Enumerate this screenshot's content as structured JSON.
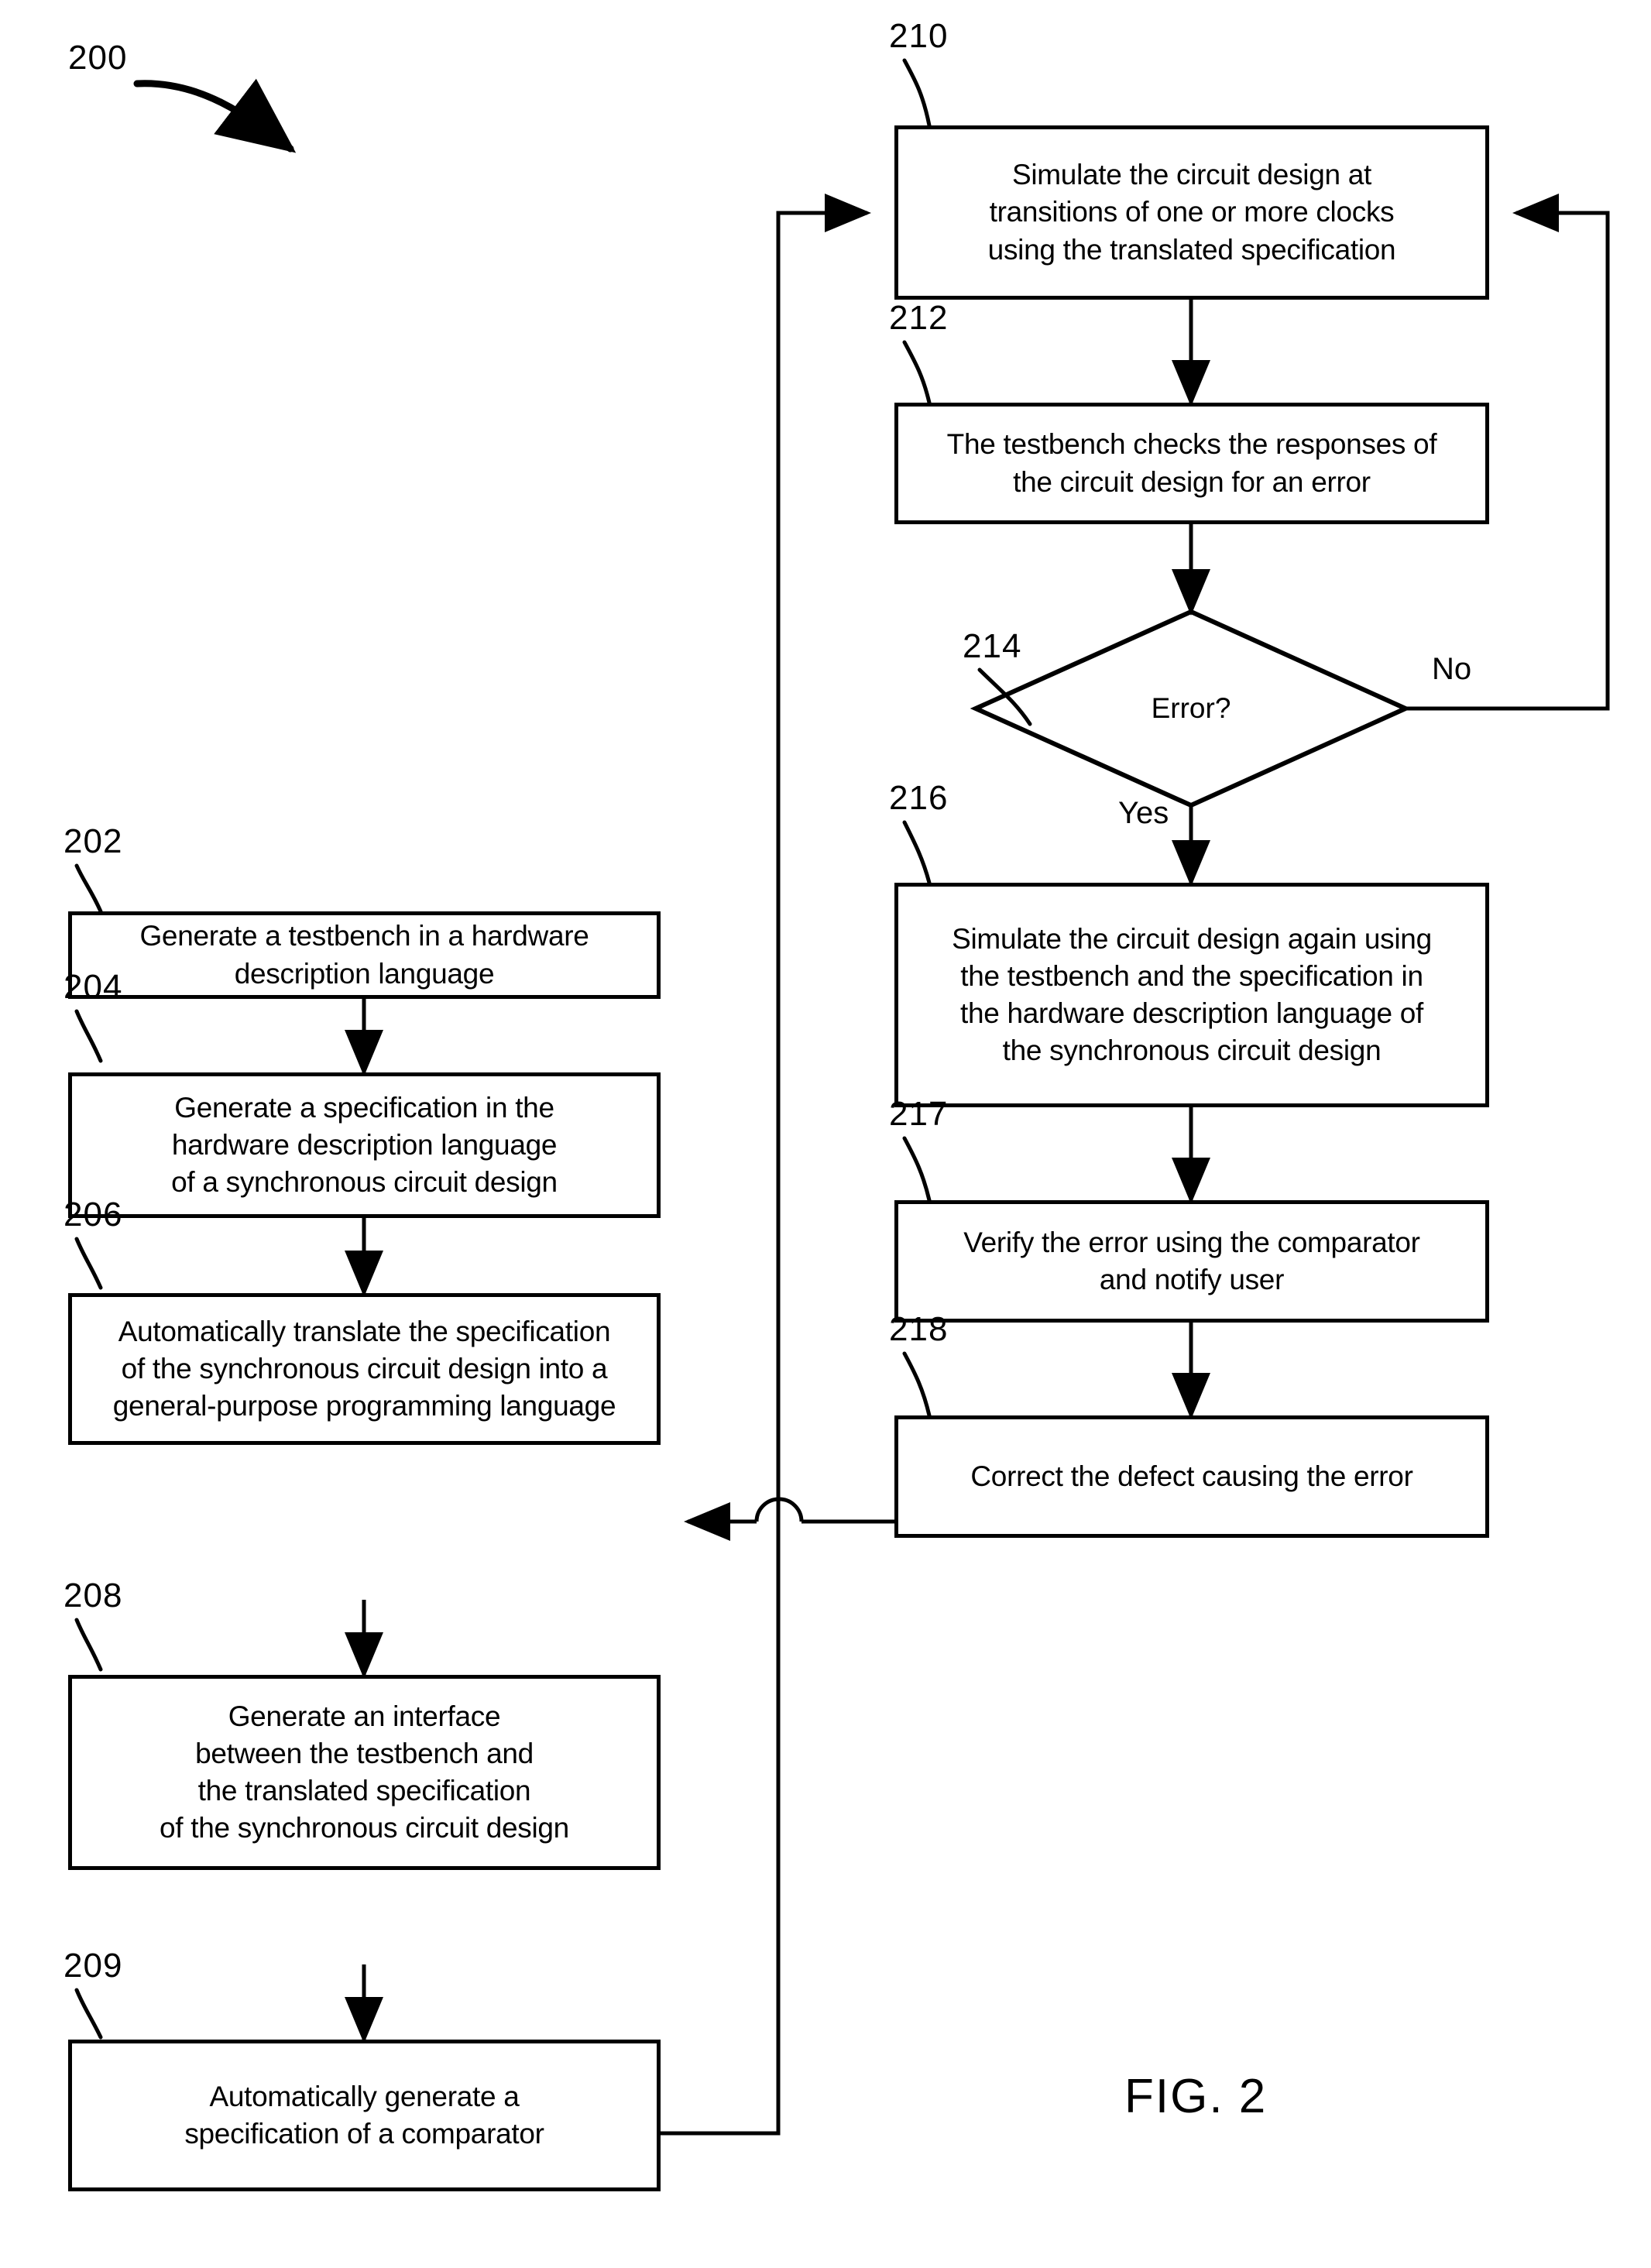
{
  "figure": {
    "caption": "FIG. 2",
    "diagram_ref": "200"
  },
  "nodes": [
    {
      "ref": "202",
      "shape": "process",
      "lines": [
        "Generate a testbench in a hardware",
        "description language"
      ],
      "text": "Generate a testbench in a hardware description language"
    },
    {
      "ref": "204",
      "shape": "process",
      "lines": [
        "Generate a specification in the",
        "hardware description language",
        "of a synchronous circuit design"
      ],
      "text": "Generate a specification in the hardware description language of a synchronous circuit design"
    },
    {
      "ref": "206",
      "shape": "process",
      "lines": [
        "Automatically translate the specification",
        "of the synchronous circuit design into a",
        "general-purpose programming language"
      ],
      "text": "Automatically translate the specification of the synchronous circuit design into a general-purpose programming language"
    },
    {
      "ref": "208",
      "shape": "process",
      "lines": [
        "Generate an interface",
        "between the testbench and",
        "the translated specification",
        "of the synchronous circuit design"
      ],
      "text": "Generate an interface between the testbench and the translated specification of the synchronous circuit design"
    },
    {
      "ref": "209",
      "shape": "process",
      "lines": [
        "Automatically generate a",
        "specification of a comparator"
      ],
      "text": "Automatically generate a specification of a comparator"
    },
    {
      "ref": "210",
      "shape": "process",
      "lines": [
        "Simulate the circuit design at",
        "transitions of one or more clocks",
        "using the translated specification"
      ],
      "text": "Simulate the circuit design at transitions of one or more clocks using the translated specification"
    },
    {
      "ref": "212",
      "shape": "process",
      "lines": [
        "The testbench checks the responses of",
        "the circuit design for an error"
      ],
      "text": "The testbench checks the responses of the circuit design for an error"
    },
    {
      "ref": "214",
      "shape": "decision",
      "lines": [
        "Error?"
      ],
      "text": "Error?"
    },
    {
      "ref": "216",
      "shape": "process",
      "lines": [
        "Simulate the circuit design again using",
        "the testbench and the specification in",
        "the hardware description language of",
        "the synchronous circuit design"
      ],
      "text": "Simulate the circuit design again using the testbench and the specification in the hardware description language of the synchronous circuit design"
    },
    {
      "ref": "217",
      "shape": "process",
      "lines": [
        "Verify the error using the comparator",
        "and notify user"
      ],
      "text": "Verify the error using the comparator and notify user"
    },
    {
      "ref": "218",
      "shape": "process",
      "lines": [
        "Correct the defect causing the error"
      ],
      "text": "Correct the defect causing the error"
    }
  ],
  "branch_labels": {
    "yes": "Yes",
    "no": "No"
  },
  "colors": {
    "stroke": "#000000",
    "background": "#ffffff"
  }
}
